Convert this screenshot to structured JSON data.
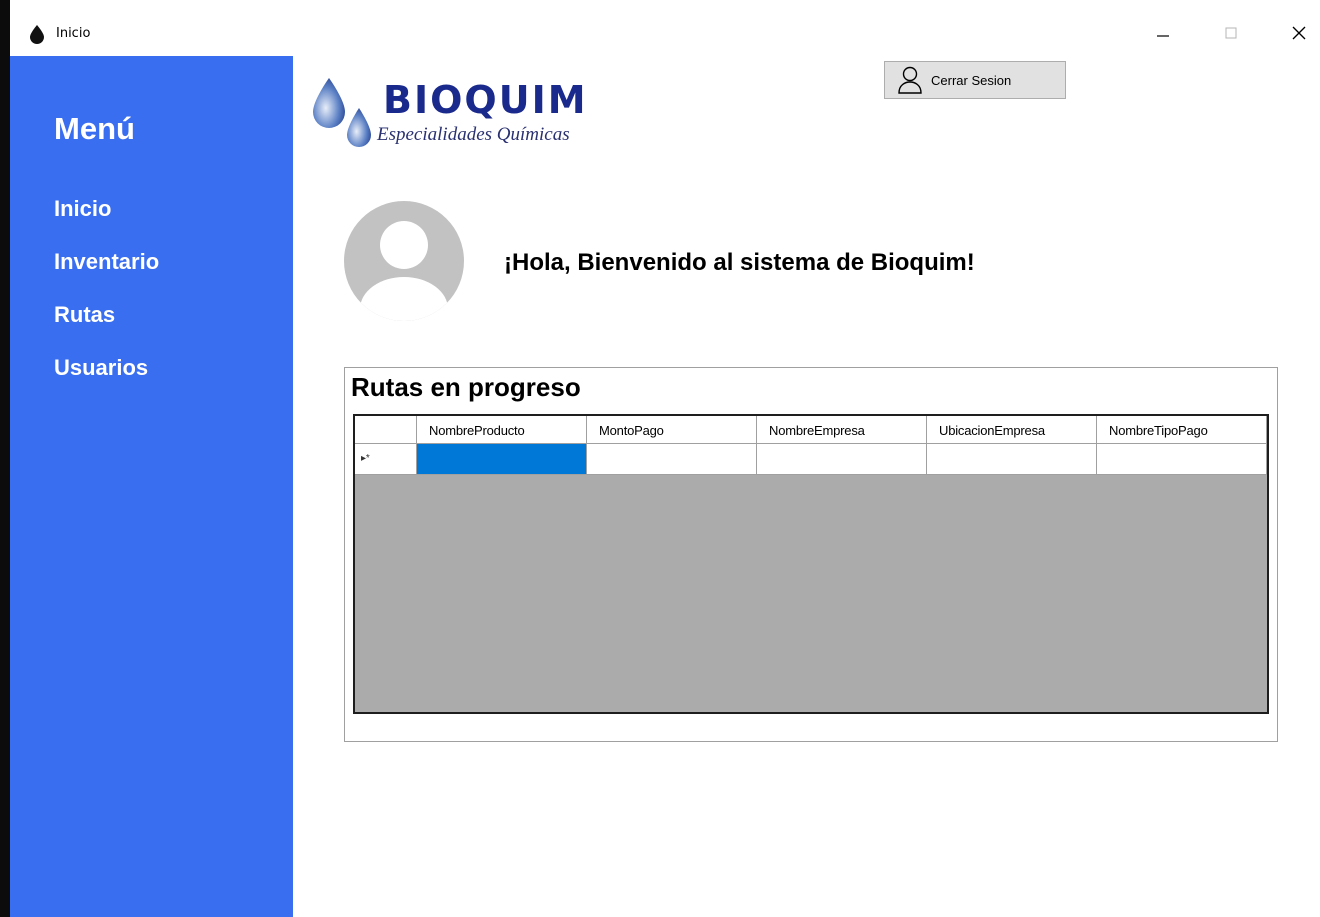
{
  "window": {
    "title": "Inicio"
  },
  "sidebar": {
    "title": "Menú",
    "items": [
      {
        "label": "Inicio"
      },
      {
        "label": "Inventario"
      },
      {
        "label": "Rutas"
      },
      {
        "label": "Usuarios"
      }
    ]
  },
  "colors": {
    "sidebar_bg": "#3a6ef0",
    "selected_cell": "#0078d7",
    "grid_background": "#ababab"
  },
  "logo": {
    "name": "BIOQUIM",
    "tagline": "Especialidades Químicas"
  },
  "header": {
    "logout_label": "Cerrar Sesion"
  },
  "main": {
    "welcome": "¡Hola, Bienvenido al sistema de Bioquim!",
    "group_title": "Rutas en progreso",
    "grid": {
      "columns": [
        "NombreProducto",
        "MontoPago",
        "NombreEmpresa",
        "UbicacionEmpresa",
        "NombreTipoPago"
      ],
      "new_row_marker": "▸*",
      "rows": []
    }
  }
}
